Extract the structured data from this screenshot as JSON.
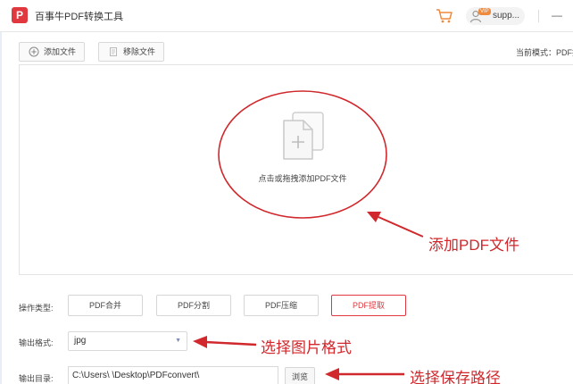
{
  "window": {
    "title": "百事牛PDF转换工具",
    "logo_letter": "P",
    "user_badge": "VIP",
    "user_name": "supp...",
    "minimize_glyph": "—"
  },
  "toolbar": {
    "add_file_label": "添加文件",
    "remove_file_label": "移除文件",
    "mode_label": "当前模式：PDF提取"
  },
  "dropzone": {
    "hint": "点击或拖拽添加PDF文件"
  },
  "operation": {
    "label": "操作类型:",
    "buttons": [
      "PDF合并",
      "PDF分割",
      "PDF压缩",
      "PDF提取"
    ],
    "selected": "PDF提取"
  },
  "output_format": {
    "label": "输出格式:",
    "value": "jpg"
  },
  "output_dir": {
    "label": "输出目录:",
    "value": "C:\\Users\\        \\Desktop\\PDFconvert\\",
    "browse_label": "浏览"
  },
  "annotations": {
    "add_pdf": "添加PDF文件",
    "choose_format": "选择图片格式",
    "choose_path": "选择保存路径"
  },
  "colors": {
    "accent": "#e0383e",
    "annotation": "#d0282c"
  },
  "icons": [
    "logo-icon",
    "cart-icon",
    "user-icon",
    "add-file-icon",
    "remove-file-icon",
    "document-add-icon",
    "chevron-down-icon",
    "minimize-icon"
  ]
}
